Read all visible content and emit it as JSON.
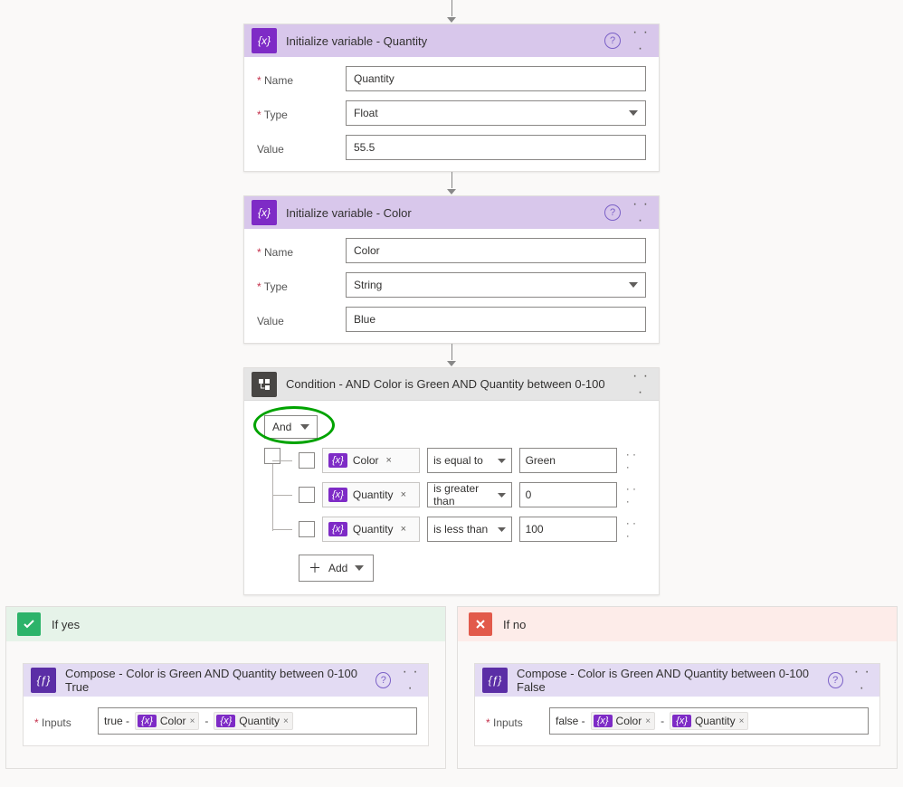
{
  "initQuantity": {
    "title": "Initialize variable - Quantity",
    "labels": {
      "name": "Name",
      "type": "Type",
      "value": "Value"
    },
    "values": {
      "name": "Quantity",
      "type": "Float",
      "value": "55.5"
    }
  },
  "initColor": {
    "title": "Initialize variable - Color",
    "labels": {
      "name": "Name",
      "type": "Type",
      "value": "Value"
    },
    "values": {
      "name": "Color",
      "type": "String",
      "value": "Blue"
    }
  },
  "condition": {
    "title": "Condition - AND Color is Green AND Quantity between 0-100",
    "aggregator": "And",
    "addLabel": "Add",
    "rows": [
      {
        "field": "Color",
        "operator": "is equal to",
        "value": "Green"
      },
      {
        "field": "Quantity",
        "operator": "is greater than",
        "value": "0"
      },
      {
        "field": "Quantity",
        "operator": "is less than",
        "value": "100"
      }
    ]
  },
  "branches": {
    "yes": {
      "title": "If yes",
      "compose": {
        "title": "Compose - Color is Green AND Quantity between 0-100 True",
        "inputsLabel": "Inputs",
        "prefix": "true -",
        "tokens": [
          "Color",
          "Quantity"
        ]
      }
    },
    "no": {
      "title": "If no",
      "compose": {
        "title": "Compose - Color is Green AND Quantity between 0-100 False",
        "inputsLabel": "Inputs",
        "prefix": "false -",
        "tokens": [
          "Color",
          "Quantity"
        ]
      }
    }
  }
}
